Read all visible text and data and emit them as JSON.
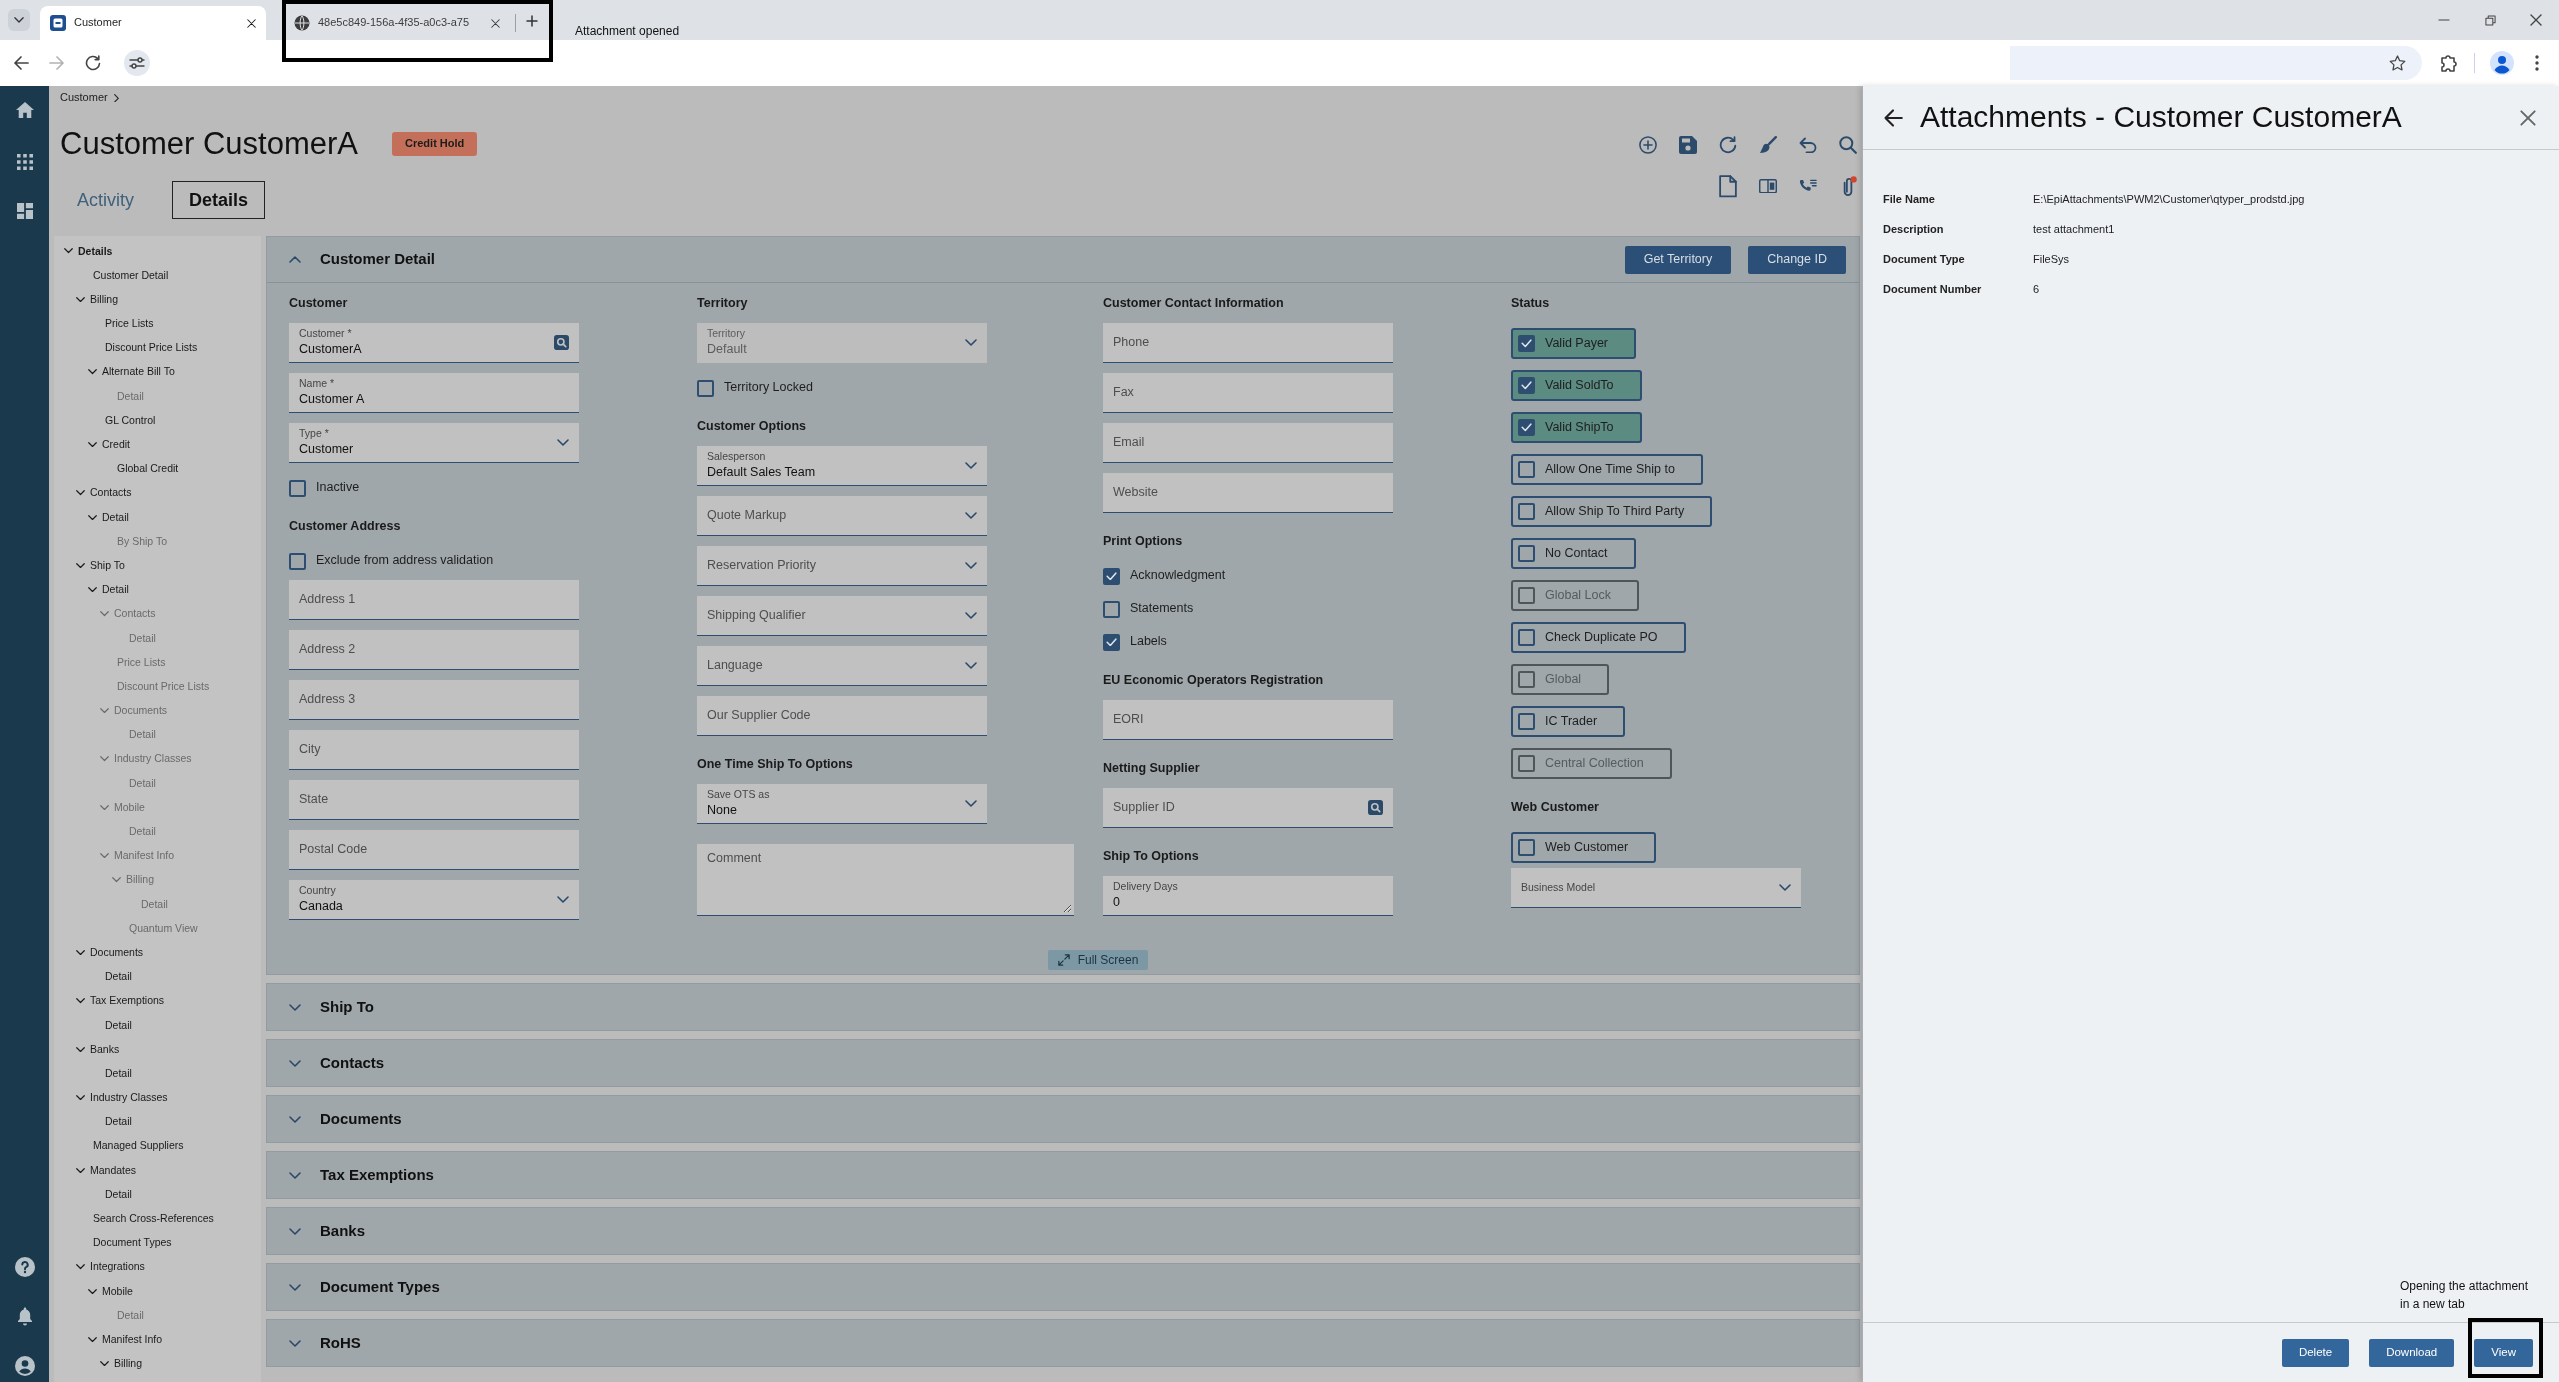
{
  "browser": {
    "tabs": [
      {
        "title": "Customer",
        "kind": "app",
        "selected": true,
        "highlighted": false
      },
      {
        "title": "48e5c849-156a-4f35-a0c3-a75",
        "kind": "web",
        "selected": false,
        "highlighted": true
      }
    ],
    "notice": "Attachment opened"
  },
  "breadcrumb": [
    "Customer"
  ],
  "page": {
    "title": "Customer CustomerA",
    "badge": "Credit Hold"
  },
  "view_tabs": [
    {
      "label": "Activity",
      "selected": false
    },
    {
      "label": "Details",
      "selected": true
    }
  ],
  "tree": [
    {
      "label": "Details",
      "expanded": true,
      "disabled": false,
      "children": [
        {
          "label": "Customer Detail",
          "disabled": false
        },
        {
          "label": "Billing",
          "expanded": true,
          "disabled": false,
          "children": [
            {
              "label": "Price Lists",
              "disabled": false
            },
            {
              "label": "Discount Price Lists",
              "disabled": false
            },
            {
              "label": "Alternate Bill To",
              "expanded": true,
              "disabled": false,
              "children": [
                {
                  "label": "Detail",
                  "disabled": true
                }
              ]
            },
            {
              "label": "GL Control",
              "disabled": false
            },
            {
              "label": "Credit",
              "expanded": true,
              "disabled": false,
              "children": [
                {
                  "label": "Global Credit",
                  "disabled": false
                }
              ]
            }
          ]
        },
        {
          "label": "Contacts",
          "expanded": true,
          "disabled": false,
          "children": [
            {
              "label": "Detail",
              "expanded": true,
              "disabled": false,
              "children": [
                {
                  "label": "By Ship To",
                  "disabled": true
                }
              ]
            }
          ]
        },
        {
          "label": "Ship To",
          "expanded": true,
          "disabled": false,
          "children": [
            {
              "label": "Detail",
              "expanded": true,
              "disabled": false,
              "children": [
                {
                  "label": "Contacts",
                  "expanded": true,
                  "disabled": true,
                  "children": [
                    {
                      "label": "Detail",
                      "disabled": true
                    }
                  ]
                },
                {
                  "label": "Price Lists",
                  "disabled": true
                },
                {
                  "label": "Discount Price Lists",
                  "disabled": true
                },
                {
                  "label": "Documents",
                  "expanded": true,
                  "disabled": true,
                  "children": [
                    {
                      "label": "Detail",
                      "disabled": true
                    }
                  ]
                },
                {
                  "label": "Industry Classes",
                  "expanded": true,
                  "disabled": true,
                  "children": [
                    {
                      "label": "Detail",
                      "disabled": true
                    }
                  ]
                },
                {
                  "label": "Mobile",
                  "expanded": true,
                  "disabled": true,
                  "children": [
                    {
                      "label": "Detail",
                      "disabled": true
                    }
                  ]
                },
                {
                  "label": "Manifest Info",
                  "expanded": true,
                  "disabled": true,
                  "children": [
                    {
                      "label": "Billing",
                      "expanded": true,
                      "disabled": true,
                      "children": [
                        {
                          "label": "Detail",
                          "disabled": true
                        }
                      ]
                    },
                    {
                      "label": "Quantum View",
                      "disabled": true
                    }
                  ]
                }
              ]
            }
          ]
        },
        {
          "label": "Documents",
          "expanded": true,
          "disabled": false,
          "children": [
            {
              "label": "Detail",
              "disabled": false
            }
          ]
        },
        {
          "label": "Tax Exemptions",
          "expanded": true,
          "disabled": false,
          "children": [
            {
              "label": "Detail",
              "disabled": false
            }
          ]
        },
        {
          "label": "Banks",
          "expanded": true,
          "disabled": false,
          "children": [
            {
              "label": "Detail",
              "disabled": false
            }
          ]
        },
        {
          "label": "Industry Classes",
          "expanded": true,
          "disabled": false,
          "children": [
            {
              "label": "Detail",
              "disabled": false
            }
          ]
        },
        {
          "label": "Managed Suppliers",
          "disabled": false
        },
        {
          "label": "Mandates",
          "expanded": true,
          "disabled": false,
          "children": [
            {
              "label": "Detail",
              "disabled": false
            }
          ]
        },
        {
          "label": "Search Cross-References",
          "disabled": false
        },
        {
          "label": "Document Types",
          "disabled": false
        },
        {
          "label": "Integrations",
          "expanded": true,
          "disabled": false,
          "children": [
            {
              "label": "Mobile",
              "expanded": true,
              "disabled": false,
              "children": [
                {
                  "label": "Detail",
                  "disabled": true
                }
              ]
            },
            {
              "label": "Manifest Info",
              "expanded": true,
              "disabled": false,
              "children": [
                {
                  "label": "Billing",
                  "expanded": true,
                  "disabled": false
                }
              ]
            }
          ]
        }
      ]
    }
  ],
  "sections": [
    {
      "title": "Customer Detail",
      "expanded": true,
      "buttons": [
        "Get Territory",
        "Change ID"
      ],
      "columns": [
        {
          "groups": [
            {
              "heading": "Customer",
              "items": [
                {
                  "kind": "lookup",
                  "label": "Customer *",
                  "value": "CustomerA",
                  "disabled": false
                },
                {
                  "kind": "text",
                  "label": "Name *",
                  "value": "Customer A",
                  "disabled": false
                },
                {
                  "kind": "dropdown",
                  "label": "Type *",
                  "value": "Customer",
                  "disabled": false
                },
                {
                  "kind": "checkbox",
                  "label": "Inactive",
                  "checked": false,
                  "disabled": false
                }
              ]
            },
            {
              "heading": "Customer Address",
              "items": [
                {
                  "kind": "checkbox",
                  "label": "Exclude from address validation",
                  "checked": false,
                  "disabled": false
                },
                {
                  "kind": "text",
                  "placeholder": "Address 1",
                  "disabled": false
                },
                {
                  "kind": "text",
                  "placeholder": "Address 2",
                  "disabled": false
                },
                {
                  "kind": "text",
                  "placeholder": "Address 3",
                  "disabled": false
                },
                {
                  "kind": "text",
                  "placeholder": "City",
                  "disabled": false
                },
                {
                  "kind": "text",
                  "placeholder": "State",
                  "disabled": false
                },
                {
                  "kind": "text",
                  "placeholder": "Postal Code",
                  "disabled": false
                },
                {
                  "kind": "dropdown",
                  "label": "Country",
                  "value": "Canada",
                  "disabled": false
                }
              ]
            }
          ]
        },
        {
          "groups": [
            {
              "heading": "Territory",
              "items": [
                {
                  "kind": "dropdown",
                  "label": "Territory",
                  "value": "Default",
                  "disabled": true
                },
                {
                  "kind": "checkbox",
                  "label": "Territory Locked",
                  "checked": false,
                  "disabled": false
                }
              ]
            },
            {
              "heading": "Customer Options",
              "items": [
                {
                  "kind": "dropdown",
                  "label": "Salesperson",
                  "value": "Default Sales Team",
                  "disabled": false
                },
                {
                  "kind": "dropdown",
                  "placeholder": "Quote Markup",
                  "disabled": false
                },
                {
                  "kind": "dropdown",
                  "placeholder": "Reservation Priority",
                  "disabled": false
                },
                {
                  "kind": "dropdown",
                  "placeholder": "Shipping Qualifier",
                  "disabled": false
                },
                {
                  "kind": "dropdown",
                  "placeholder": "Language",
                  "disabled": false
                },
                {
                  "kind": "text",
                  "placeholder": "Our Supplier Code",
                  "disabled": false
                }
              ]
            },
            {
              "heading": "One Time Ship To Options",
              "items": [
                {
                  "kind": "dropdown",
                  "label": "Save OTS as",
                  "value": "None",
                  "disabled": false
                },
                {
                  "kind": "textarea",
                  "placeholder": "Comment",
                  "disabled": false
                }
              ]
            }
          ]
        },
        {
          "groups": [
            {
              "heading": "Customer Contact Information",
              "items": [
                {
                  "kind": "text",
                  "placeholder": "Phone",
                  "disabled": false
                },
                {
                  "kind": "text",
                  "placeholder": "Fax",
                  "disabled": false
                },
                {
                  "kind": "text",
                  "placeholder": "Email",
                  "disabled": false
                },
                {
                  "kind": "text",
                  "placeholder": "Website",
                  "disabled": false
                }
              ]
            },
            {
              "heading": "Print Options",
              "items": [
                {
                  "kind": "checkbox",
                  "label": "Acknowledgment",
                  "checked": true,
                  "disabled": false
                },
                {
                  "kind": "checkbox",
                  "label": "Statements",
                  "checked": false,
                  "disabled": false
                },
                {
                  "kind": "checkbox",
                  "label": "Labels",
                  "checked": true,
                  "disabled": false
                }
              ]
            },
            {
              "heading": "EU Economic Operators Registration",
              "items": [
                {
                  "kind": "text",
                  "placeholder": "EORI",
                  "disabled": false
                }
              ]
            },
            {
              "heading": "Netting Supplier",
              "items": [
                {
                  "kind": "lookup",
                  "placeholder": "Supplier ID",
                  "disabled": false
                }
              ]
            },
            {
              "heading": "Ship To Options",
              "items": [
                {
                  "kind": "text",
                  "label": "Delivery Days",
                  "value": "0",
                  "disabled": false
                }
              ]
            }
          ]
        },
        {
          "groups": [
            {
              "heading": "Status",
              "items": [
                {
                  "kind": "toggle",
                  "label": "Valid Payer",
                  "checked": true,
                  "disabled": false
                },
                {
                  "kind": "toggle",
                  "label": "Valid SoldTo",
                  "checked": true,
                  "disabled": false
                },
                {
                  "kind": "toggle",
                  "label": "Valid ShipTo",
                  "checked": true,
                  "disabled": false
                },
                {
                  "kind": "toggle",
                  "label": "Allow One Time Ship to",
                  "checked": false,
                  "disabled": false
                },
                {
                  "kind": "toggle",
                  "label": "Allow Ship To Third Party",
                  "checked": false,
                  "disabled": false
                },
                {
                  "kind": "toggle",
                  "label": "No Contact",
                  "checked": false,
                  "disabled": false
                },
                {
                  "kind": "toggle",
                  "label": "Global Lock",
                  "checked": false,
                  "disabled": true
                },
                {
                  "kind": "toggle",
                  "label": "Check Duplicate PO",
                  "checked": false,
                  "disabled": false
                },
                {
                  "kind": "toggle",
                  "label": "Global",
                  "checked": false,
                  "disabled": true
                },
                {
                  "kind": "toggle",
                  "label": "IC Trader",
                  "checked": false,
                  "disabled": false
                },
                {
                  "kind": "toggle",
                  "label": "Central Collection",
                  "checked": false,
                  "disabled": true
                }
              ]
            },
            {
              "heading": "Web Customer",
              "items": [
                {
                  "kind": "toggle",
                  "label": "Web Customer",
                  "checked": false,
                  "disabled": false
                },
                {
                  "kind": "dropdown",
                  "label": "Business Model",
                  "disabled": false
                }
              ]
            }
          ]
        }
      ],
      "footer_button": "Full Screen"
    },
    {
      "title": "Ship To",
      "expanded": false
    },
    {
      "title": "Contacts",
      "expanded": false
    },
    {
      "title": "Documents",
      "expanded": false
    },
    {
      "title": "Tax Exemptions",
      "expanded": false
    },
    {
      "title": "Banks",
      "expanded": false
    },
    {
      "title": "Document Types",
      "expanded": false
    },
    {
      "title": "RoHS",
      "expanded": false
    }
  ],
  "attachment_panel": {
    "title": "Attachments - Customer CustomerA",
    "fields": [
      {
        "label": "File Name",
        "value": "E:\\EpiAttachments\\PWM2\\Customer\\qtyper_prodstd.jpg"
      },
      {
        "label": "Description",
        "value": "test attachment1"
      },
      {
        "label": "Document Type",
        "value": "FileSys"
      },
      {
        "label": "Document Number",
        "value": "6"
      }
    ],
    "note": "Opening the attachment in a new tab",
    "buttons": [
      {
        "label": "Delete",
        "highlighted": false
      },
      {
        "label": "Download",
        "highlighted": false
      },
      {
        "label": "View",
        "highlighted": true
      }
    ]
  }
}
